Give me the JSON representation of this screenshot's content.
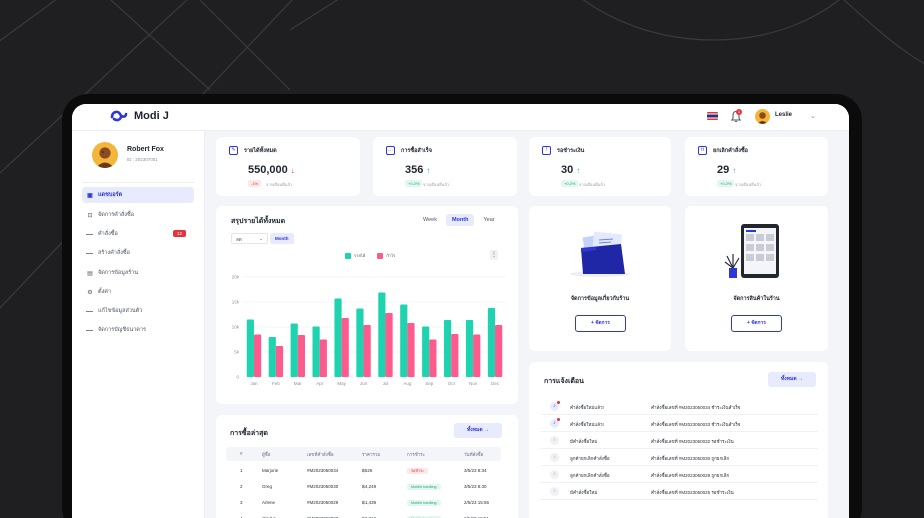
{
  "app": {
    "name": "Modi J"
  },
  "topbar": {
    "user_name": "Leslie",
    "notif_count": "1"
  },
  "profile": {
    "name": "Robert Fox",
    "id": "ID : 202307001"
  },
  "sidebar": {
    "items": [
      {
        "label": "แดชบอร์ด",
        "icon": "dashboard-icon"
      },
      {
        "label": "จัดการคำสั่งซื้อ",
        "icon": "bag-icon"
      },
      {
        "label": "คำสั่งซื้อ",
        "badge": "12"
      },
      {
        "label": "สร้างคำสั่งซื้อ"
      },
      {
        "label": "จัดการข้อมูลร้าน",
        "icon": "clipboard-icon"
      },
      {
        "label": "ตั้งค่า",
        "icon": "gear-icon"
      },
      {
        "label": "แก้ไขข้อมูลส่วนตัว"
      },
      {
        "label": "จัดการบัญชีธนาคาร"
      }
    ]
  },
  "stats": [
    {
      "title": "รายได้ทั้งหมด",
      "value": "550,000",
      "trend": "↓",
      "change": "-1%",
      "note": "จากเดือนที่แล้ว",
      "icon": "edit-icon"
    },
    {
      "title": "การซื้อสำเร็จ",
      "value": "356",
      "trend": "↑",
      "change": "+0.2%",
      "note": "จากเดือนที่แล้ว",
      "icon": "chat-icon"
    },
    {
      "title": "รอชำระเงิน",
      "value": "30",
      "trend": "↑",
      "change": "+0.2%",
      "note": "จากเดือนที่แล้ว",
      "icon": "info-icon"
    },
    {
      "title": "ยกเลิกคำสั่งซื้อ",
      "value": "29",
      "trend": "↑",
      "change": "+0.2%",
      "note": "จากเดือนที่แล้ว",
      "icon": "lock-icon"
    }
  ],
  "summary": {
    "title": "สรุปรายได้ทั้งหมด",
    "tabs": [
      "Week",
      "Month",
      "Year"
    ],
    "active_tab": "Month",
    "filter_value": "ลด",
    "filter_tag": "Month"
  },
  "chart_data": {
    "type": "bar",
    "categories": [
      "Jan",
      "Feb",
      "Mar",
      "Apr",
      "May",
      "Jun",
      "Jul",
      "Aug",
      "Sep",
      "Oct",
      "Nov",
      "Dec"
    ],
    "series": [
      {
        "name": "รายได้",
        "color": "#1ed3b0",
        "values": [
          11500,
          8000,
          10700,
          10100,
          15700,
          13700,
          16900,
          14500,
          10100,
          11400,
          11400,
          13800
        ]
      },
      {
        "name": "กำไร",
        "color": "#fd5a8d",
        "values": [
          8500,
          6200,
          8400,
          7500,
          11800,
          10400,
          12800,
          10800,
          7500,
          8600,
          8500,
          10400
        ]
      }
    ],
    "ylim": [
      0,
      20000
    ],
    "yticks": [
      "20k",
      "15k",
      "10k",
      "5k",
      "0"
    ],
    "grid": true,
    "legend": "top"
  },
  "shop_info": {
    "title": "จัดการข้อมูลเกี่ยวกับร้าน",
    "button": "+ จัดการ"
  },
  "shop_products": {
    "title": "จัดการสินค้าในร้าน",
    "button": "+ จัดการ"
  },
  "recent": {
    "title": "การซื้อล่าสุด",
    "all_button": "ทั้งหมด",
    "headers": [
      "#",
      "ผู้ซื้อ",
      "เลขที่คำสั่งซื้อ",
      "ราคารวม",
      "การชำระ",
      "วันที่สั่งซื้อ"
    ],
    "rows": [
      {
        "n": "1",
        "buyer": "Marjorie",
        "order": "#M2023050034",
        "total": "฿526",
        "payment": "รอชำระ",
        "date": "3/5/23 8:34"
      },
      {
        "n": "2",
        "buyer": "Greg",
        "order": "#M2023050030",
        "total": "฿4,249",
        "payment": "Mobile banking",
        "date": "3/5/23 8:30"
      },
      {
        "n": "3",
        "buyer": "Arlene",
        "order": "#M2023050029",
        "total": "฿1,439",
        "payment": "Mobile banking",
        "date": "2/5/23 15:56"
      },
      {
        "n": "4",
        "buyer": "Gladys",
        "order": "#M2023050028",
        "total": "฿2,819",
        "payment": "Mobile banking",
        "date": "2/5/23 15:51"
      }
    ]
  },
  "notifications": {
    "title": "การแจ้งเตือน",
    "all_button": "ทั้งหมด",
    "items": [
      {
        "label": "คำสั่งซื้อใหม่แล้ว!",
        "desc": "คำสั่งซื้อเลขที่ #M2023050034 ชำระเงินสำเร็จ",
        "unread": true
      },
      {
        "label": "คำสั่งซื้อใหม่แล้ว!",
        "desc": "คำสั่งซื้อเลขที่ #M2023050033 ชำระเงินสำเร็จ",
        "unread": true
      },
      {
        "label": "มีคำสั่งซื้อใหม่",
        "desc": "คำสั่งซื้อเลขที่ #M2023050032 รอชำระเงิน",
        "unread": false
      },
      {
        "label": "ลูกค้ายกเลิกคำสั่งซื้อ",
        "desc": "คำสั่งซื้อเลขที่ #M2023050030 ถูกยกเลิก",
        "unread": false
      },
      {
        "label": "ลูกค้ายกเลิกคำสั่งซื้อ",
        "desc": "คำสั่งซื้อเลขที่ #M2023050029 ถูกยกเลิก",
        "unread": false
      },
      {
        "label": "มีคำสั่งซื้อใหม่",
        "desc": "คำสั่งซื้อเลขที่ #M2023050025 รอชำระเงิน",
        "unread": false
      }
    ]
  },
  "colors": {
    "accent": "#2c37d6",
    "revenue": "#1ed3b0",
    "profit": "#fd5a8d",
    "danger": "#e4333b"
  }
}
